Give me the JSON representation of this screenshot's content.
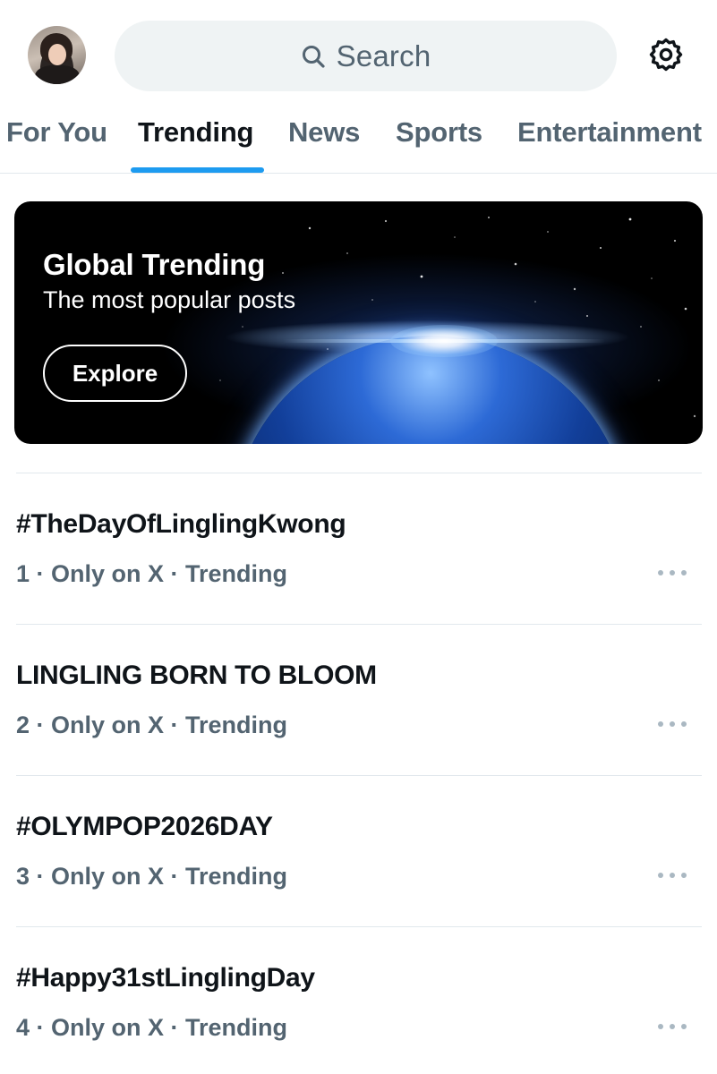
{
  "header": {
    "avatar": "avatar",
    "search": {
      "placeholder": "Search",
      "icon": "search-icon"
    },
    "settings_icon": "gear-icon"
  },
  "tabs": [
    {
      "label": "For You",
      "active": false
    },
    {
      "label": "Trending",
      "active": true
    },
    {
      "label": "News",
      "active": false
    },
    {
      "label": "Sports",
      "active": false
    },
    {
      "label": "Entertainment",
      "active": false
    }
  ],
  "banner": {
    "title": "Global Trending",
    "subtitle": "The most popular posts",
    "button_label": "Explore"
  },
  "trends": [
    {
      "title": "#TheDayOfLinglingKwong",
      "meta": "1 · Only on X · Trending"
    },
    {
      "title": "LINGLING BORN TO BLOOM",
      "meta": "2 · Only on X · Trending"
    },
    {
      "title": "#OLYMPOP2026DAY",
      "meta": "3 · Only on X · Trending"
    },
    {
      "title": "#Happy31stLinglingDay",
      "meta": "4 · Only on X · Trending"
    }
  ],
  "colors": {
    "accent": "#1d9bf0",
    "text_primary": "#0f1419",
    "text_secondary": "#536471",
    "search_bg": "#eff3f4",
    "divider": "#e1e8ed"
  }
}
